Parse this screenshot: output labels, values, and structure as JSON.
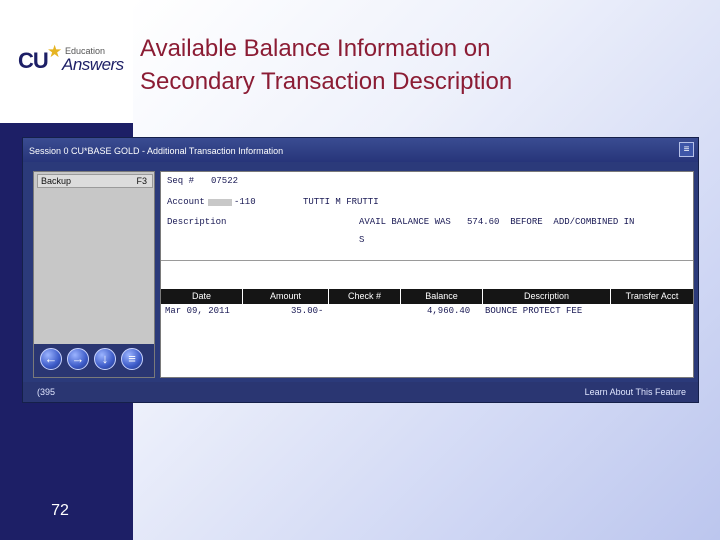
{
  "logo": {
    "cu": "CU",
    "education": "Education",
    "answers": "Answers"
  },
  "slide": {
    "title_line1": "Available Balance Information on",
    "title_line2": "Secondary Transaction Description",
    "number": "72"
  },
  "window": {
    "title": "Session 0 CU*BASE GOLD - Additional Transaction Information",
    "sidebar": {
      "backup_label": "Backup",
      "backup_key": "F3"
    },
    "nav_icons": [
      "back-arrow-icon",
      "forward-arrow-icon",
      "down-arrow-icon",
      "menu-icon"
    ],
    "fields": {
      "seq_label": "Seq #",
      "seq_value": "07522",
      "account_label": "Account",
      "account_suffix": "-110",
      "account_name": "TUTTI M FRUTTI",
      "description_label": "Description",
      "description_line1": "AVAIL BALANCE WAS   574.60  BEFORE  ADD/COMBINED IN",
      "description_line2": "S"
    },
    "grid": {
      "columns": [
        "Date",
        "Amount",
        "Check #",
        "Balance",
        "Description",
        "Transfer Acct"
      ],
      "rows": [
        {
          "date": "Mar 09, 2011",
          "amount": "35.00-",
          "check": "",
          "balance": "4,960.40",
          "description": "BOUNCE PROTECT FEE",
          "transfer": ""
        }
      ]
    },
    "status": {
      "left": "(395",
      "right": "Learn About This Feature"
    }
  }
}
